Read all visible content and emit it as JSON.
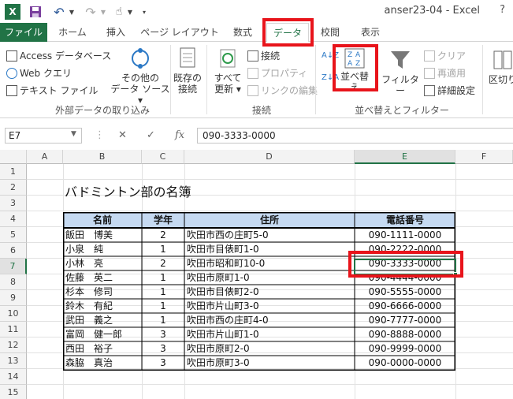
{
  "window": {
    "title": "anser23-04 - Excel",
    "help": "?"
  },
  "quick_access": {
    "app_icon": "X",
    "save_icon": "save-icon",
    "undo": "↶",
    "redo": "↷",
    "touch": "☝"
  },
  "tabs": [
    {
      "label": "ファイル"
    },
    {
      "label": "ホーム"
    },
    {
      "label": "挿入"
    },
    {
      "label": "ページ レイアウト"
    },
    {
      "label": "数式"
    },
    {
      "label": "データ"
    },
    {
      "label": "校閲"
    },
    {
      "label": "表示"
    }
  ],
  "ribbon": {
    "external": {
      "access": "Access データベース",
      "web": "Web クエリ",
      "text": "テキスト ファイル",
      "other_line1": "その他の",
      "other_line2": "データ ソース",
      "group": "外部データの取り込み"
    },
    "connections": {
      "existing_line1": "既存の",
      "existing_line2": "接続",
      "refresh_line1": "すべて",
      "refresh_line2": "更新",
      "connect": "接続",
      "properties": "プロパティ",
      "edit_links": "リンクの編集",
      "group": "接続"
    },
    "sort": {
      "sort_label": "並べ替え",
      "filter_label": "フィルター",
      "clear": "クリア",
      "reapply": "再適用",
      "advanced": "詳細設定",
      "group": "並べ替えとフィルター"
    },
    "tools": {
      "text_to_cols": "区切り"
    }
  },
  "formula_bar": {
    "name_box": "E7",
    "cancel": "✕",
    "enter": "✓",
    "fx": "fx",
    "value": "090-3333-0000"
  },
  "columns": [
    "A",
    "B",
    "C",
    "D",
    "E",
    "F"
  ],
  "rows": [
    "1",
    "2",
    "3",
    "4",
    "5",
    "6",
    "7",
    "8",
    "9",
    "10",
    "11",
    "12",
    "13",
    "14",
    "15",
    "16"
  ],
  "sheet": {
    "title": "バドミントン部の名簿",
    "headers": [
      "名前",
      "学年",
      "住所",
      "電話番号"
    ],
    "records": [
      {
        "name": "飯田　博美",
        "grade": "2",
        "address": "吹田市西の庄町5-0",
        "phone": "090-1111-0000"
      },
      {
        "name": "小泉　純",
        "grade": "1",
        "address": "吹田市目俵町1-0",
        "phone": "090-2222-0000"
      },
      {
        "name": "小林　亮",
        "grade": "2",
        "address": "吹田市昭和町10-0",
        "phone": "090-3333-0000"
      },
      {
        "name": "佐藤　英二",
        "grade": "1",
        "address": "吹田市原町1-0",
        "phone": "090-4444-0000"
      },
      {
        "name": "杉本　修司",
        "grade": "1",
        "address": "吹田市目俵町2-0",
        "phone": "090-5555-0000"
      },
      {
        "name": "鈴木　有紀",
        "grade": "1",
        "address": "吹田市片山町3-0",
        "phone": "090-6666-0000"
      },
      {
        "name": "武田　義之",
        "grade": "1",
        "address": "吹田市西の庄町4-0",
        "phone": "090-7777-0000"
      },
      {
        "name": "富岡　健一郎",
        "grade": "3",
        "address": "吹田市片山町1-0",
        "phone": "090-8888-0000"
      },
      {
        "name": "西田　裕子",
        "grade": "3",
        "address": "吹田市原町2-0",
        "phone": "090-9999-0000"
      },
      {
        "name": "森脇　真治",
        "grade": "3",
        "address": "吹田市原町3-0",
        "phone": "090-0000-0000"
      }
    ]
  },
  "colors": {
    "accent": "#217346",
    "highlight": "#e8141b",
    "header_fill": "#c5d9f1"
  }
}
